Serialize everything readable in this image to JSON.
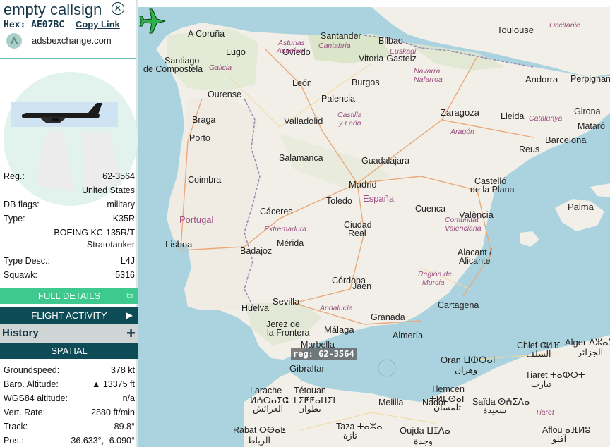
{
  "sidebar": {
    "callsign": "empty callsign",
    "hex_label": "Hex:",
    "hex_value": "AE07BC",
    "copy_link": "Copy Link",
    "source": "adsbexchange.com",
    "fields": {
      "reg_label": "Reg.:",
      "reg_value": "62-3564",
      "country": "United States",
      "dbflags_label": "DB flags:",
      "dbflags_value": "military",
      "type_label": "Type:",
      "type_value": "K35R",
      "type_name": "BOEING KC-135R/T Stratotanker",
      "typedesc_label": "Type Desc.:",
      "typedesc_value": "L4J",
      "squawk_label": "Squawk:",
      "squawk_value": "5316"
    },
    "buttons": {
      "full_details": "FULL DETAILS",
      "flight_activity": "FLIGHT ACTIVITY",
      "history": "History",
      "spatial": "SPATIAL"
    },
    "spatial": {
      "groundspeed_label": "Groundspeed:",
      "groundspeed_value": "378 kt",
      "baro_label": "Baro. Altitude:",
      "baro_value": "▲ 13375 ft",
      "wgs_label": "WGS84 altitude:",
      "wgs_value": "n/a",
      "vrate_label": "Vert. Rate:",
      "vrate_value": "2880 ft/min",
      "track_label": "Track:",
      "track_value": "89.8°",
      "pos_label": "Pos.:",
      "pos_value": "36.633°, -6.090°"
    }
  },
  "map": {
    "aircraft_label": "reg: 62-3564",
    "aircraft_color": "#2db34a",
    "labels": {
      "acoruna": "A Coruña",
      "santander": "Santander",
      "bilbao": "Bilbao",
      "toulouse": "Toulouse",
      "occitanie": "Occitanie",
      "oviedo": "Oviedo",
      "asturias": "Asturias",
      "asturias_ast": "Asturies",
      "cantabria": "Cantabria",
      "euskadi": "Euskadi",
      "vitoria": "Vitoria-Gasteiz",
      "santiago": "Santiago",
      "decompostela": "de Compostela",
      "galicia": "Galicia",
      "lugo": "Lugo",
      "navarra": "Navarra",
      "nafarroa": "Nafarroa",
      "andorra": "Andorra",
      "perpignan": "Perpignan",
      "leon": "León",
      "burgos": "Burgos",
      "ourense": "Ourense",
      "palencia": "Palencia",
      "zaragoza": "Zaragoza",
      "girona": "Girona",
      "braga": "Braga",
      "valladolid": "Valladolid",
      "castilla": "Castilla",
      "yleon": "y León",
      "lleida": "Lleida",
      "catalunya": "Catalunya",
      "mataro": "Mataró",
      "porto": "Porto",
      "aragon": "Aragón",
      "reus": "Reus",
      "barcelona": "Barcelona",
      "salamanca": "Salamanca",
      "guadalajara": "Guadalajara",
      "coimbra": "Coimbra",
      "madrid": "Madrid",
      "castello": "Castelló",
      "delaplana": "de la Plana",
      "espana": "España",
      "toledo": "Toledo",
      "palma": "Palma",
      "portugal": "Portugal",
      "caceres": "Cáceres",
      "cuenca": "Cuenca",
      "extremadura": "Extremadura",
      "valencia": "València",
      "comunitat": "Comunitat",
      "valenciana": "Valenciana",
      "ciudad": "Ciudad",
      "real": "Real",
      "lisboa": "Lisboa",
      "merida": "Mérida",
      "badajoz": "Badajoz",
      "alacant": "Alacant /",
      "alicante": "Alicante",
      "region": "Región de",
      "murcia": "Murcia",
      "cordoba": "Córdoba",
      "jaen": "Jaén",
      "sevilla": "Sevilla",
      "cartagena": "Cartagena",
      "huelva": "Huelva",
      "andalucia": "Andalucía",
      "jerez": "Jerez de",
      "lafrontera": "la Frontera",
      "granada": "Granada",
      "malaga": "Málaga",
      "almeria": "Almería",
      "marbella": "Marbella",
      "gibraltar": "Gibraltar",
      "chlef": "Chlef ⵛⵍⴼ",
      "chlef_ar": "الشلف",
      "alger": "Alger ⴷⵣⴰⵢ",
      "alger_ar": "الجزائر",
      "oran": "Oran ⵡⵀⵔⴰⵏ",
      "oran_ar": "وهران",
      "tiaret": "Tiaret ⵜⴰⵀⵔⵜ",
      "tiaret_ar": "تيارت",
      "larache": "Larache",
      "larache_tf": "ⵍⵄⵔⴰⵢⵛ",
      "larache_ar": "العرائش",
      "tetouan": "Tétouan",
      "tetouan_tf": "ⵜⵉⵟⵟⴰⵡⵉⵏ",
      "tetouan_ar": "تطوان",
      "tlemcen": "Tlemcen",
      "tlemcen_tf": "ⵜⵍⵎⵙⴰⵏ",
      "tlemcen_ar": "تلمسان",
      "melilla": "Melilla",
      "nador": "Nador",
      "saida": "Saïda ⵙⵄⵉⴷⴰ",
      "saida_ar": "سعيدة",
      "tiaret_it": "Tiaret",
      "rabat": "Rabat ⵔⴱⴰⵟ",
      "rabat_ar": "الرباط",
      "taza": "Taza ⵜⴰⵣⴰ",
      "taza_ar": "تازة",
      "oujda": "Oujda ⵡⵊⴷⴰ",
      "oujda_ar": "وجدة",
      "aflou": "Aflou ⴰⴼⵍⵓ",
      "aflou_ar": "آفلو"
    }
  }
}
